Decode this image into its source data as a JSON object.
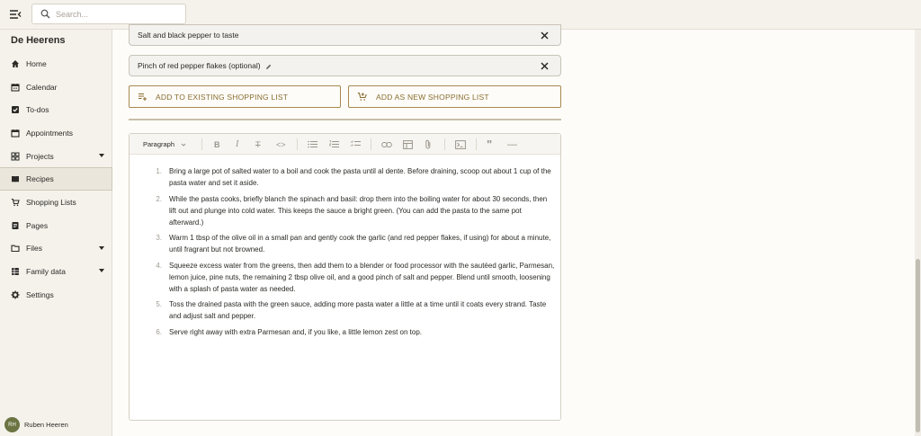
{
  "header": {
    "search_placeholder": "Search..."
  },
  "sidebar": {
    "brand": "De Heerens",
    "items": [
      {
        "label": "Home",
        "icon": "home-icon",
        "active": false,
        "expandable": false
      },
      {
        "label": "Calendar",
        "icon": "calendar-icon",
        "active": false,
        "expandable": false
      },
      {
        "label": "To-dos",
        "icon": "checkbox-icon",
        "active": false,
        "expandable": false
      },
      {
        "label": "Appointments",
        "icon": "calendar-blank-icon",
        "active": false,
        "expandable": false
      },
      {
        "label": "Projects",
        "icon": "grid-icon",
        "active": false,
        "expandable": true
      },
      {
        "label": "Recipes",
        "icon": "book-icon",
        "active": true,
        "expandable": false
      },
      {
        "label": "Shopping Lists",
        "icon": "cart-icon",
        "active": false,
        "expandable": false
      },
      {
        "label": "Pages",
        "icon": "page-icon",
        "active": false,
        "expandable": false
      },
      {
        "label": "Files",
        "icon": "folder-icon",
        "active": false,
        "expandable": true
      },
      {
        "label": "Family data",
        "icon": "database-icon",
        "active": false,
        "expandable": true
      },
      {
        "label": "Settings",
        "icon": "gear-icon",
        "active": false,
        "expandable": false
      }
    ],
    "user": {
      "initials": "RH",
      "name": "Ruben Heeren"
    }
  },
  "ingredients": [
    {
      "text": "Salt and black pepper to taste"
    },
    {
      "text": "Pinch of red pepper flakes (optional)"
    }
  ],
  "actions": {
    "add_existing": "ADD TO EXISTING SHOPPING LIST",
    "add_new": "ADD AS NEW SHOPPING LIST"
  },
  "editor": {
    "block_type": "Paragraph",
    "toolbar_icons": [
      "bold-icon",
      "italic-icon",
      "strikethrough-icon",
      "code-icon",
      "bullet-list-icon",
      "numbered-list-icon",
      "checklist-icon",
      "link-icon",
      "table-icon",
      "attachment-icon",
      "code-block-icon",
      "quote-icon",
      "horizontal-rule-icon"
    ],
    "steps": [
      {
        "num": "1.",
        "text": "Bring a large pot of salted water to a boil and cook the pasta until al dente. Before draining, scoop out about 1 cup of the pasta water and set it aside."
      },
      {
        "num": "2.",
        "text": "While the pasta cooks, briefly blanch the spinach and basil: drop them into the boiling water for about 30 seconds, then lift out and plunge into cold water. This keeps the sauce a bright green. (You can add the pasta to the same pot afterward.)"
      },
      {
        "num": "3.",
        "text": "Warm 1 tbsp of the olive oil in a small pan and gently cook the garlic (and red pepper flakes, if using) for about a minute, until fragrant but not browned."
      },
      {
        "num": "4.",
        "text": "Squeeze excess water from the greens, then add them to a blender or food processor with the sautéed garlic, Parmesan, lemon juice, pine nuts, the remaining 2 tbsp olive oil, and a good pinch of salt and pepper. Blend until smooth, loosening with a splash of pasta water as needed."
      },
      {
        "num": "5.",
        "text": "Toss the drained pasta with the green sauce, adding more pasta water a little at a time until it coats every strand. Taste and adjust salt and pepper."
      },
      {
        "num": "6.",
        "text": "Serve right away with extra Parmesan and, if you like, a little lemon zest on top."
      }
    ]
  },
  "colors": {
    "accent": "#8a6d2f",
    "avatar": "#6b7442",
    "sidebar_bg": "#f5f2ec"
  }
}
